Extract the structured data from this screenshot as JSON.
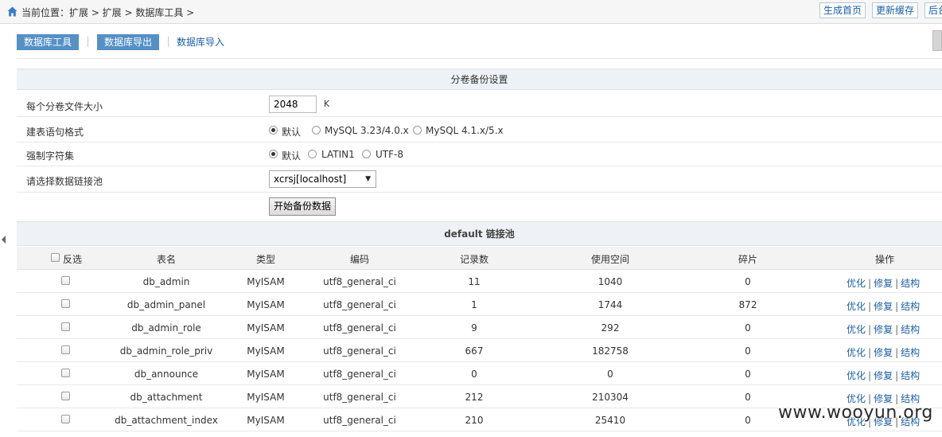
{
  "breadcrumb": "当前位置：扩展 > 扩展 > 数据库工具 >",
  "top_buttons": [
    "生成首页",
    "更新缓存",
    "后台"
  ],
  "tabs": [
    "数据库工具",
    "数据库导出",
    "数据库导入"
  ],
  "settings": {
    "header": "分卷备份设置",
    "volume_size_label": "每个分卷文件大小",
    "volume_size_value": "2048",
    "volume_size_unit": "K",
    "table_format_label": "建表语句格式",
    "table_format_options": [
      "默认",
      "MySQL 3.23/4.0.x",
      "MySQL 4.1.x/5.x"
    ],
    "table_format_selected": "默认",
    "charset_label": "强制字符集",
    "charset_options": [
      "默认",
      "LATIN1",
      "UTF-8"
    ],
    "charset_selected": "默认",
    "pool_label": "请选择数据链接池",
    "pool_value": "xcrsj[localhost]",
    "start_button": "开始备份数据"
  },
  "table": {
    "title": "default 链接池",
    "headers": {
      "invert": "反选",
      "name": "表名",
      "type": "类型",
      "encoding": "编码",
      "records": "记录数",
      "space": "使用空间",
      "fragments": "碎片",
      "actions": "操作"
    },
    "action_labels": [
      "优化",
      "修复",
      "结构"
    ],
    "rows": [
      {
        "name": "db_admin",
        "type": "MyISAM",
        "encoding": "utf8_general_ci",
        "records": "11",
        "space": "1040",
        "fragments": "0"
      },
      {
        "name": "db_admin_panel",
        "type": "MyISAM",
        "encoding": "utf8_general_ci",
        "records": "1",
        "space": "1744",
        "fragments": "872"
      },
      {
        "name": "db_admin_role",
        "type": "MyISAM",
        "encoding": "utf8_general_ci",
        "records": "9",
        "space": "292",
        "fragments": "0"
      },
      {
        "name": "db_admin_role_priv",
        "type": "MyISAM",
        "encoding": "utf8_general_ci",
        "records": "667",
        "space": "182758",
        "fragments": "0"
      },
      {
        "name": "db_announce",
        "type": "MyISAM",
        "encoding": "utf8_general_ci",
        "records": "0",
        "space": "0",
        "fragments": "0"
      },
      {
        "name": "db_attachment",
        "type": "MyISAM",
        "encoding": "utf8_general_ci",
        "records": "212",
        "space": "210304",
        "fragments": "0"
      },
      {
        "name": "db_attachment_index",
        "type": "MyISAM",
        "encoding": "utf8_general_ci",
        "records": "210",
        "space": "25410",
        "fragments": "0"
      }
    ]
  },
  "watermark": "www.wooyun.org",
  "colors": {
    "accent": "#5590c6",
    "link": "#1c5fa3",
    "header_bg": "#eef1f5"
  }
}
